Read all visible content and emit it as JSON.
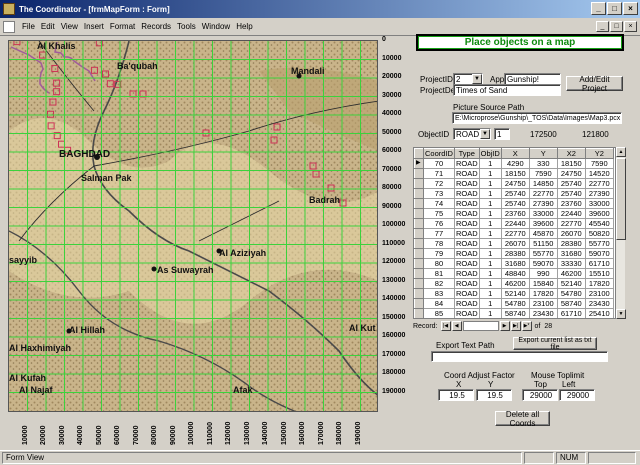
{
  "window": {
    "title": "The Coordinator - [frmMapForm : Form]",
    "min": "_",
    "max": "□",
    "close": "×"
  },
  "menu": [
    "File",
    "Edit",
    "View",
    "Insert",
    "Format",
    "Records",
    "Tools",
    "Window",
    "Help"
  ],
  "map": {
    "place_names": [
      "Al Khalis",
      "Ba'qubah",
      "Mandali",
      "BAGHDAD",
      "Salman Pak",
      "Badrah",
      "As Suwayrah",
      "Al Aziziyah",
      "Al Kut",
      "sayyib",
      "Al Hillah",
      "Al Haxhimiyah",
      "Al Kufah",
      "Al Najaf",
      "Afak"
    ],
    "x_axis_labels": [
      "10000",
      "20000",
      "30000",
      "40000",
      "50000",
      "60000",
      "70000",
      "80000",
      "90000",
      "100000",
      "110000",
      "120000",
      "130000",
      "140000",
      "150000",
      "160000",
      "170000",
      "180000",
      "190000"
    ],
    "y_axis_labels": [
      "0",
      "10000",
      "20000",
      "30000",
      "40000",
      "50000",
      "60000",
      "70000",
      "80000",
      "90000",
      "100000",
      "110000",
      "120000",
      "130000",
      "140000",
      "150000",
      "160000",
      "170000",
      "180000",
      "190000"
    ]
  },
  "panel": {
    "header": "Place objects on a map",
    "project_id_label": "ProjectID:",
    "project_id_value": "2",
    "app_label": "App",
    "app_value": "Gunship!",
    "project_desc_label": "ProjectDesc:",
    "project_desc_value": "Times of Sand",
    "add_edit_project": "Add/Edit Project",
    "picture_source_label": "Picture Source Path",
    "picture_source_value": "E:\\Microprose\\Gunship\\_TOS\\Data\\Images\\Map3.pcx",
    "object_id_label": "ObjectID",
    "object_type_value": "ROAD",
    "object_id_value": "1",
    "readout_x": "172500",
    "readout_y": "121800"
  },
  "grid": {
    "columns": [
      "CoordID",
      "Type",
      "ObjID",
      "X",
      "Y",
      "X2",
      "Y2"
    ],
    "rows": [
      [
        "70",
        "ROAD",
        "1",
        "4290",
        "330",
        "18150",
        "7590"
      ],
      [
        "71",
        "ROAD",
        "1",
        "18150",
        "7590",
        "24750",
        "14520"
      ],
      [
        "72",
        "ROAD",
        "1",
        "24750",
        "14850",
        "25740",
        "22770"
      ],
      [
        "73",
        "ROAD",
        "1",
        "25740",
        "22770",
        "25740",
        "27390"
      ],
      [
        "74",
        "ROAD",
        "1",
        "25740",
        "27390",
        "23760",
        "33000"
      ],
      [
        "75",
        "ROAD",
        "1",
        "23760",
        "33000",
        "22440",
        "39600"
      ],
      [
        "76",
        "ROAD",
        "1",
        "22440",
        "39600",
        "22770",
        "45540"
      ],
      [
        "77",
        "ROAD",
        "1",
        "22770",
        "45870",
        "26070",
        "50820"
      ],
      [
        "78",
        "ROAD",
        "1",
        "26070",
        "51150",
        "28380",
        "55770"
      ],
      [
        "79",
        "ROAD",
        "1",
        "28380",
        "55770",
        "31680",
        "59070"
      ],
      [
        "80",
        "ROAD",
        "1",
        "31680",
        "59070",
        "33330",
        "61710"
      ],
      [
        "81",
        "ROAD",
        "1",
        "48840",
        "990",
        "46200",
        "15510"
      ],
      [
        "82",
        "ROAD",
        "1",
        "46200",
        "15840",
        "52140",
        "17820"
      ],
      [
        "83",
        "ROAD",
        "1",
        "52140",
        "17820",
        "54780",
        "23100"
      ],
      [
        "84",
        "ROAD",
        "1",
        "54780",
        "23100",
        "58740",
        "23430"
      ],
      [
        "85",
        "ROAD",
        "1",
        "58740",
        "23430",
        "61710",
        "25410"
      ]
    ],
    "record_label": "Record:",
    "record_of": "of",
    "record_total": "28"
  },
  "export": {
    "text_path_label": "Export Text Path",
    "text_path_value": "",
    "export_button": "Export current list as txt file"
  },
  "coords": {
    "adjust_label": "Coord Adjust Factor",
    "x_label": "X",
    "y_label": "Y",
    "x_value": "19.5",
    "y_value": "19.5",
    "mouse_label": "Mouse Toplimit",
    "top_label": "Top",
    "left_label": "Left",
    "top_value": "29000",
    "left_value": "29000",
    "delete_button": "Delete all Coords"
  },
  "status": {
    "text": "Form View",
    "num": "NUM"
  }
}
